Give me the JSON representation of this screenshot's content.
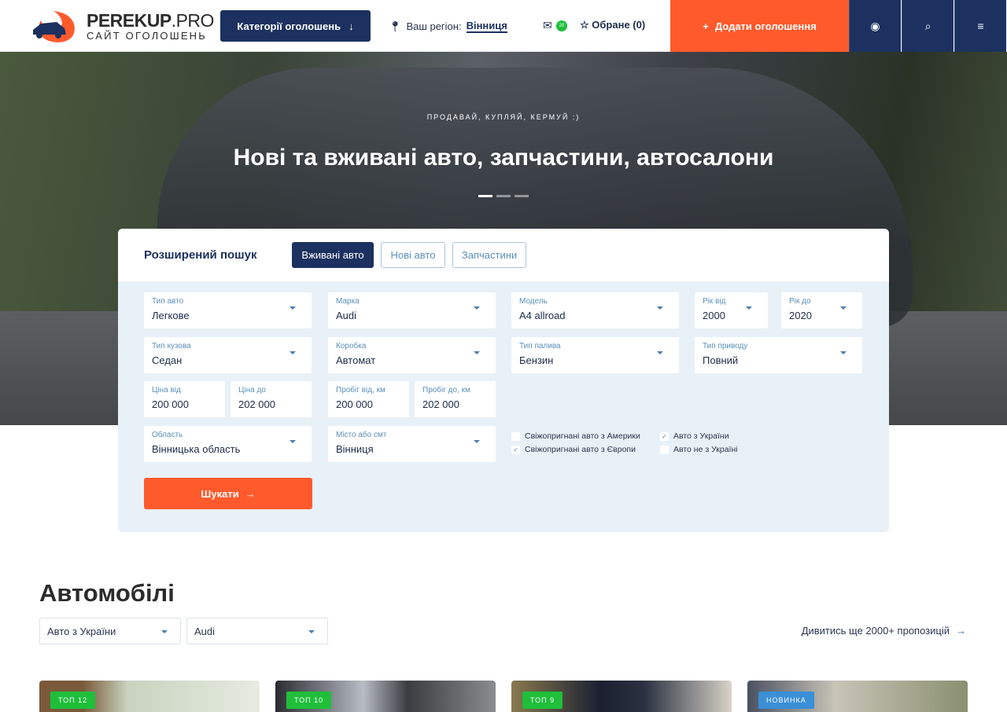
{
  "header": {
    "logo_main": "PEREKUP",
    "logo_pro": ".PRO",
    "logo_sub": "САЙТ ОГОЛОШЕНЬ",
    "categories_label": "Категорії оголошень",
    "region_label": "Ваш регіон:",
    "region_value": "Вінниця",
    "mail_count": "20",
    "favorites_label": "Обране (0)",
    "add_label": "Додати оголошення",
    "icons": [
      "user-icon",
      "search-icon",
      "menu-icon"
    ]
  },
  "hero": {
    "subtitle": "ПРОДАВАЙ, КУПЛЯЙ, КЕРМУЙ :)",
    "title": "Нові та вживані авто, запчастини, автосалони",
    "slides": 3,
    "active_slide": 1
  },
  "search": {
    "title": "Розширений пошук",
    "tabs": [
      {
        "label": "Вживані авто",
        "active": true
      },
      {
        "label": "Нові авто",
        "active": false
      },
      {
        "label": "Запчастини",
        "active": false
      }
    ],
    "fields": {
      "type": {
        "label": "Тип авто",
        "value": "Легкове"
      },
      "brand": {
        "label": "Марка",
        "value": "Audi"
      },
      "model": {
        "label": "Модель",
        "value": "A4 allroad"
      },
      "year_from": {
        "label": "Рік від",
        "value": "2000"
      },
      "year_to": {
        "label": "Рік до",
        "value": "2020"
      },
      "body": {
        "label": "Тип кузова",
        "value": "Седан"
      },
      "gearbox": {
        "label": "Коробка",
        "value": "Автомат"
      },
      "fuel": {
        "label": "Тип палива",
        "value": "Бензин"
      },
      "drive": {
        "label": "Тип приводу",
        "value": "Повний"
      },
      "price_from": {
        "label": "Ціна від",
        "value": "200 000"
      },
      "price_to": {
        "label": "Ціна до",
        "value": "202 000"
      },
      "mileage_from": {
        "label": "Пробіг від, км",
        "value": "200 000"
      },
      "mileage_to": {
        "label": "Пробіг до, км",
        "value": "202 000"
      },
      "oblast": {
        "label": "Область",
        "value": "Вінницька область"
      },
      "city": {
        "label": "Місто або смт",
        "value": "Вінниця"
      }
    },
    "checkboxes": [
      {
        "label": "Свіжопригнані авто з Америки",
        "checked": false
      },
      {
        "label": "Свіжопригнані авто з Європи",
        "checked": true
      },
      {
        "label": "Авто з України",
        "checked": true
      },
      {
        "label": "Авто не з Україні",
        "checked": false
      }
    ],
    "submit_label": "Шукати"
  },
  "cars": {
    "title": "Автомобілі",
    "filter1": "Авто з України",
    "filter2": "Audi",
    "more_label": "Дивитись ще 2000+ пропозицій",
    "cards": [
      {
        "tag": "ТОП 12",
        "color": "#1fbf3a"
      },
      {
        "tag": "ТОП 10",
        "color": "#1fbf3a"
      },
      {
        "tag": "ТОП 9",
        "color": "#1fbf3a"
      },
      {
        "tag": "НОВИНКА",
        "color": "#3a8fd6"
      }
    ]
  },
  "colors": {
    "navy": "#1c3160",
    "orange": "#ff5a2c",
    "panel": "#e8f1f8"
  }
}
